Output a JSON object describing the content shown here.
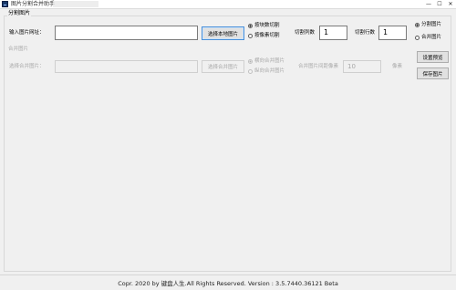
{
  "window": {
    "title": "图片分割合并助手",
    "minimize_glyph": "—",
    "maximize_glyph": "☐",
    "close_glyph": "✕"
  },
  "split_group": {
    "title": "分割图片",
    "input_label": "输入图片网址：",
    "input_value": "",
    "select_button": "选择本地图片",
    "mode_options": [
      "按块数切割",
      "按像素切割"
    ],
    "mode_selected": 0,
    "rows_label": "切割列数",
    "rows_value": "1",
    "cols_label": "切割行数",
    "cols_value": "1"
  },
  "merge_section": {
    "title": "合并图片",
    "input_label": "选择合并图片：",
    "select_button": "选择合并图片",
    "direction_options": [
      "横向合并图片",
      "纵向合并图片"
    ],
    "spacing_label": "合并图片间距像素",
    "spacing_value": "10",
    "unit_label": "像素"
  },
  "mode_switch": {
    "options": [
      "分割图片",
      "合并图片"
    ],
    "selected": 0
  },
  "actions": {
    "settings_button": "设置预览",
    "save_button": "保存图片"
  },
  "status": {
    "text": "Copr. 2020 by 键盘人生.All Rights Reserved.  Version : 3.5.7440.36121 Beta"
  }
}
